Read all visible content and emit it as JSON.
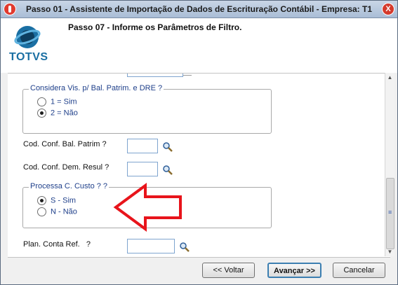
{
  "window": {
    "title": "Passo 01 - Assistente de Importação de Dados de Escrituração Contábil - Empresa: T1",
    "close_glyph": "X"
  },
  "header": {
    "logo_text": "TOTVS",
    "step_title": "Passo 07 - Informe os Parâmetros de Filtro."
  },
  "filters": {
    "group_considera": {
      "title": "Considera Vis. p/ Bal. Patrim. e DRE ?",
      "options": [
        {
          "label": "1 = Sim",
          "checked": false
        },
        {
          "label": "2 = Não",
          "checked": true
        }
      ]
    },
    "cod_conf_bal": {
      "label": "Cod. Conf. Bal. Patrim ?",
      "value": ""
    },
    "cod_conf_dem": {
      "label": "Cod. Conf. Dem. Resul ?",
      "value": ""
    },
    "group_processa": {
      "title": "Processa C. Custo ? ?",
      "options": [
        {
          "label": "S - Sim",
          "checked": true
        },
        {
          "label": "N - Não",
          "checked": false
        }
      ]
    },
    "plan_conta": {
      "label": "Plan. Conta Ref.   ?",
      "value": ""
    }
  },
  "annotation": {
    "arrow_color": "#e8141b"
  },
  "footer": {
    "back_label": "<< Voltar",
    "next_label": "Avançar >>",
    "cancel_label": "Cancelar"
  },
  "icons": [
    "app-icon",
    "close-icon",
    "totvs-logo-icon",
    "search-icon",
    "red-arrow-icon",
    "scroll-up-icon",
    "scroll-down-icon"
  ]
}
